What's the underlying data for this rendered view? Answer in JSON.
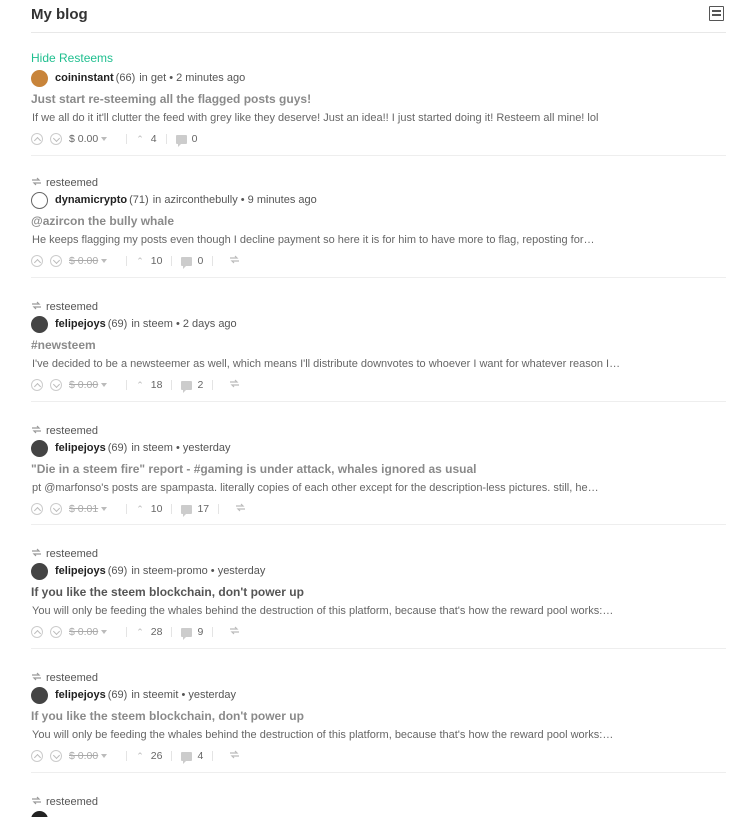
{
  "header": {
    "title": "My blog",
    "layout_icon": "list-layout-icon"
  },
  "hide_resteems": "Hide Resteems",
  "posts": [
    {
      "resteemed": false,
      "resteem_label": "",
      "author": "coininstant",
      "rep": "(66)",
      "meta": "in get • 2 minutes ago",
      "avatar_color": "#c8843a",
      "title": "Just start re-steeming all the flagged posts guys!",
      "title_dark": false,
      "body": "If we all do it it'll clutter the feed with grey like they deserve! Just an idea!! I just started doing it! Resteem all mine! lol",
      "payout": "$ 0.00",
      "payout_struck": false,
      "votes": "4",
      "comments": "0",
      "reblog": false
    },
    {
      "resteemed": true,
      "resteem_label": "resteemed",
      "author": "dynamicrypto",
      "rep": "(71)",
      "meta": "in azirconthebully • 9 minutes ago",
      "avatar_color": "#ffffff",
      "title": "@azircon the bully whale",
      "title_dark": false,
      "body": "He keeps flagging my posts even though I decline payment so here it is for him to have more to flag, reposting for…",
      "payout": "$ 0.00",
      "payout_struck": true,
      "votes": "10",
      "comments": "0",
      "reblog": true
    },
    {
      "resteemed": true,
      "resteem_label": "resteemed",
      "author": "felipejoys",
      "rep": "(69)",
      "meta": "in steem • 2 days ago",
      "avatar_color": "#444444",
      "title": "#newsteem",
      "title_dark": false,
      "body": "I've decided to be a newsteemer as well, which means I'll distribute downvotes to whoever I want for whatever reason I…",
      "payout": "$ 0.00",
      "payout_struck": true,
      "votes": "18",
      "comments": "2",
      "reblog": true
    },
    {
      "resteemed": true,
      "resteem_label": "resteemed",
      "author": "felipejoys",
      "rep": "(69)",
      "meta": "in steem • yesterday",
      "avatar_color": "#444444",
      "title": "\"Die in a steem fire\" report - #gaming is under attack, whales ignored as usual",
      "title_dark": false,
      "body": "pt @marfonso's posts are spampasta. literally copies of each other except for the description-less pictures. still, he…",
      "payout": "$ 0.01",
      "payout_struck": true,
      "votes": "10",
      "comments": "17",
      "reblog": true
    },
    {
      "resteemed": true,
      "resteem_label": "resteemed",
      "author": "felipejoys",
      "rep": "(69)",
      "meta": "in steem-promo • yesterday",
      "avatar_color": "#444444",
      "title": "If you like the steem blockchain, don't power up",
      "title_dark": true,
      "body": "You will only be feeding the whales behind the destruction of this platform, because that's how the reward pool works:…",
      "payout": "$ 0.00",
      "payout_struck": true,
      "votes": "28",
      "comments": "9",
      "reblog": true
    },
    {
      "resteemed": true,
      "resteem_label": "resteemed",
      "author": "felipejoys",
      "rep": "(69)",
      "meta": "in steemit • yesterday",
      "avatar_color": "#444444",
      "title": "If you like the steem blockchain, don't power up",
      "title_dark": false,
      "body": "You will only be feeding the whales behind the destruction of this platform, because that's how the reward pool works:…",
      "payout": "$ 0.00",
      "payout_struck": true,
      "votes": "26",
      "comments": "4",
      "reblog": true
    },
    {
      "resteemed": true,
      "resteem_label": "resteemed",
      "author": "",
      "rep": "",
      "meta": "",
      "avatar_color": "#222222",
      "title": "",
      "title_dark": false,
      "body": "",
      "payout": "",
      "payout_struck": false,
      "votes": "",
      "comments": "",
      "reblog": false
    }
  ]
}
